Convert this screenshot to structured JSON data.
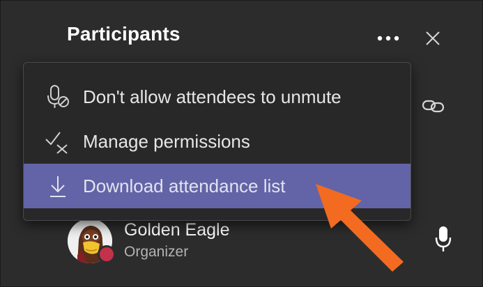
{
  "panel": {
    "title": "Participants",
    "more_icon": "more-options-icon",
    "close_icon": "close-icon",
    "link_icon": "share-link-icon"
  },
  "menu": {
    "items": [
      {
        "label": "Don't allow attendees to unmute",
        "icon": "mic-off-icon",
        "selected": false
      },
      {
        "label": "Manage permissions",
        "icon": "check-cross-icon",
        "selected": false
      },
      {
        "label": "Download attendance list",
        "icon": "download-icon",
        "selected": true
      }
    ]
  },
  "participants": [
    {
      "name": "Golden Eagle",
      "role": "Organizer",
      "status": "busy",
      "status_color": "#c4314b",
      "mic_icon": "microphone-icon"
    }
  ],
  "colors": {
    "background": "#2d2c2c",
    "menu_background": "#292828",
    "highlight": "#6264a7",
    "annotation_arrow": "#f26b21"
  }
}
